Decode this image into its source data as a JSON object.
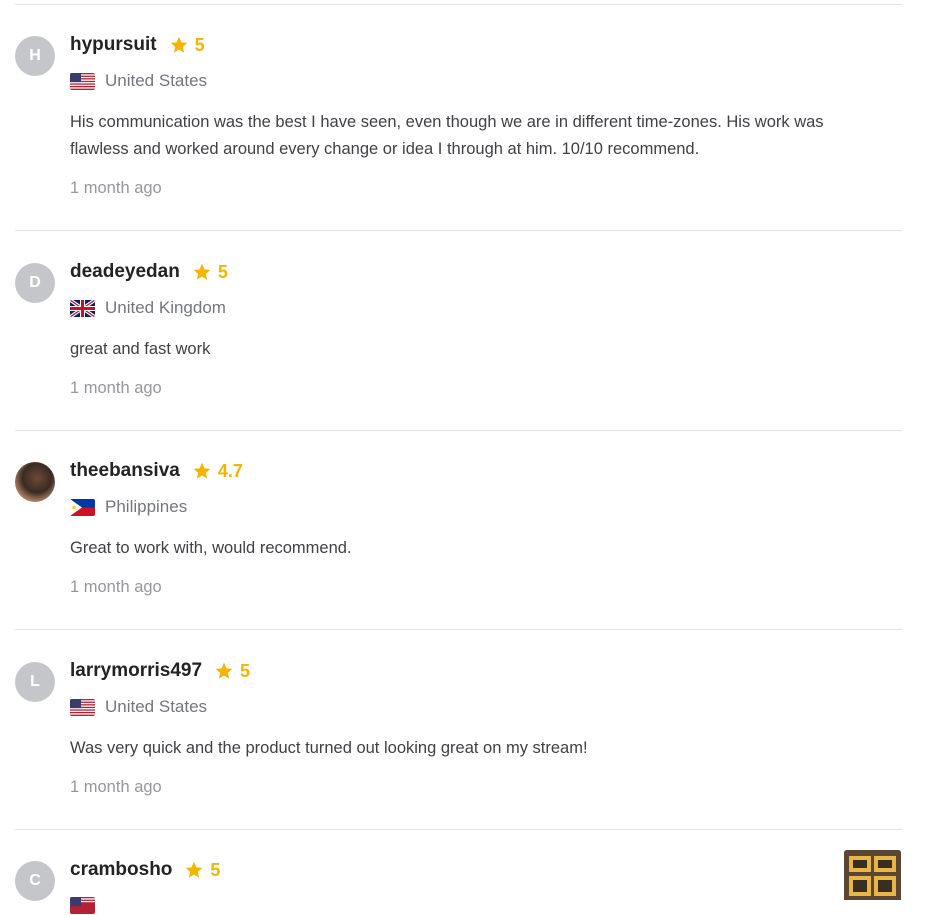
{
  "reviews": [
    {
      "avatar_initial": "H",
      "username": "hypursuit",
      "rating": "5",
      "country": "United States",
      "flag": "us-flag-icon",
      "text": "His communication was the best I have seen, even though we are in different time-zones. His work was flawless and worked around every change or idea I through at him. 10/10 recommend.",
      "time": "1 month ago"
    },
    {
      "avatar_initial": "D",
      "username": "deadeyedan",
      "rating": "5",
      "country": "United Kingdom",
      "flag": "uk-flag-icon",
      "text": "great and fast work",
      "time": "1 month ago"
    },
    {
      "avatar_initial": "",
      "username": "theebansiva",
      "rating": "4.7",
      "country": "Philippines",
      "flag": "ph-flag-icon",
      "text": "Great to work with, would recommend.",
      "time": "1 month ago"
    },
    {
      "avatar_initial": "L",
      "username": "larrymorris497",
      "rating": "5",
      "country": "United States",
      "flag": "us-flag-icon",
      "text": "Was very quick and the product turned out looking great on my stream!",
      "time": "1 month ago"
    },
    {
      "avatar_initial": "C",
      "username": "crambosho",
      "rating": "5",
      "country": "United States",
      "flag": "us-flag-icon",
      "text": "",
      "time": ""
    }
  ],
  "colors": {
    "star": "#f5b400",
    "divider": "#e4e5e7",
    "avatar_bg": "#c5c6c9"
  }
}
